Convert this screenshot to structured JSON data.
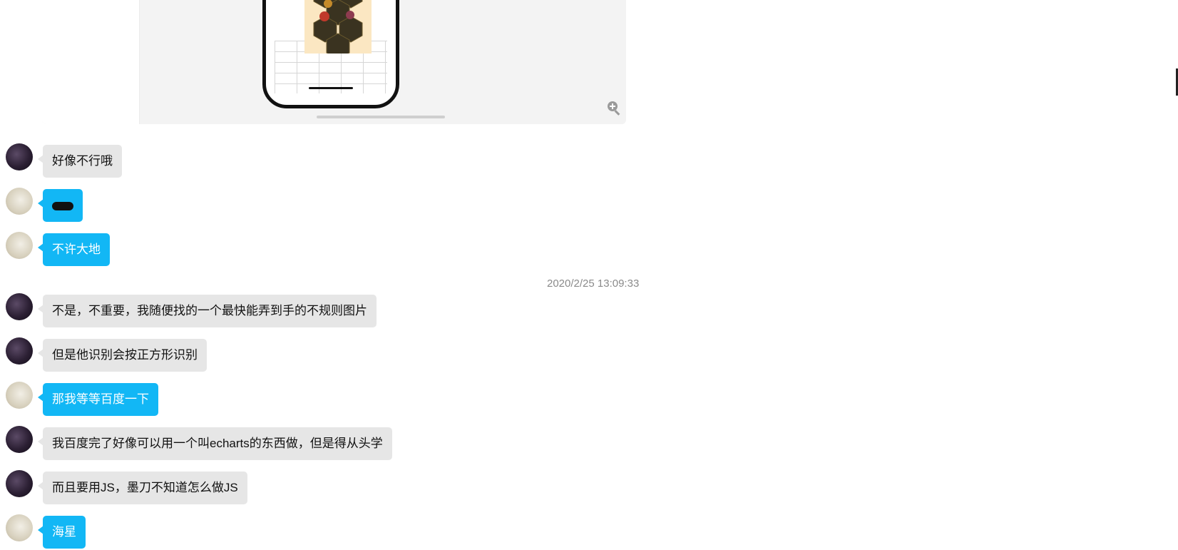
{
  "chat": {
    "timestamp": "2020/2/25 13:09:33",
    "messages": [
      {
        "side": "other",
        "text": "好像不行哦"
      },
      {
        "side": "self",
        "text": ""
      },
      {
        "side": "self",
        "text": "不许大地"
      },
      {
        "side": "other",
        "text": "不是，不重要，我随便找的一个最快能弄到手的不规则图片"
      },
      {
        "side": "other",
        "text": "但是他识别会按正方形识别"
      },
      {
        "side": "self",
        "text": "那我等等百度一下"
      },
      {
        "side": "other",
        "text": "我百度完了好像可以用一个叫echarts的东西做，但是得从头学"
      },
      {
        "side": "other",
        "text": "而且要用JS，墨刀不知道怎么做JS"
      },
      {
        "side": "self",
        "text": "海星"
      }
    ]
  },
  "icons": {
    "zoom": "zoom-in-icon"
  },
  "colors": {
    "self_bubble": "#12b7f5",
    "other_bubble": "#e6e6e6"
  }
}
